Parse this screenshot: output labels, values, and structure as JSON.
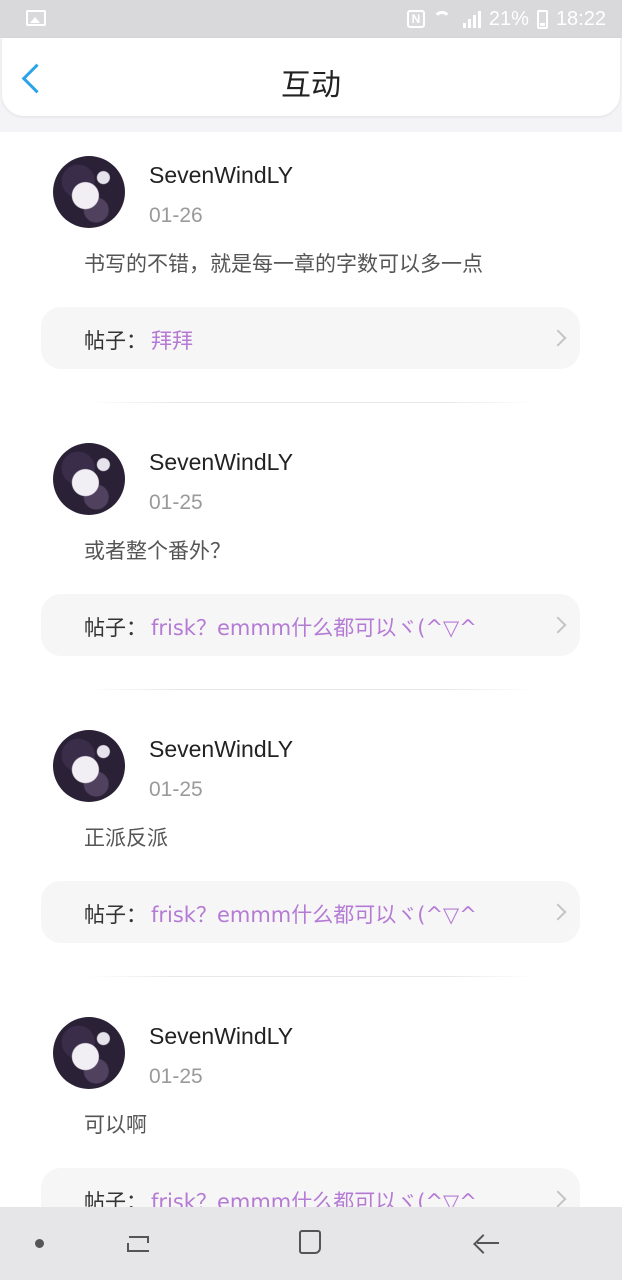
{
  "status_bar": {
    "battery": "21%",
    "time": "18:22",
    "icons": [
      "gallery-icon",
      "nfc-icon",
      "wifi-icon",
      "signal-icon",
      "battery-icon"
    ]
  },
  "header": {
    "title": "互动",
    "back_icon": "chevron-left-icon"
  },
  "colors": {
    "accent": "#2aa3e8",
    "post_title": "#b57ad4"
  },
  "comments": [
    {
      "username": "SevenWindLY",
      "date": "01-26",
      "text": "书写的不错，就是每一章的字数可以多一点",
      "post_label": "帖子：",
      "post_title": "拜拜"
    },
    {
      "username": "SevenWindLY",
      "date": "01-25",
      "text": "或者整个番外？",
      "post_label": "帖子：",
      "post_title": "frisk？emmm什么都可以ヾ(^▽^"
    },
    {
      "username": "SevenWindLY",
      "date": "01-25",
      "text": "正派反派",
      "post_label": "帖子：",
      "post_title": "frisk？emmm什么都可以ヾ(^▽^"
    },
    {
      "username": "SevenWindLY",
      "date": "01-25",
      "text": "可以啊",
      "post_label": "帖子：",
      "post_title": "frisk？emmm什么都可以ヾ(^▽^"
    }
  ]
}
